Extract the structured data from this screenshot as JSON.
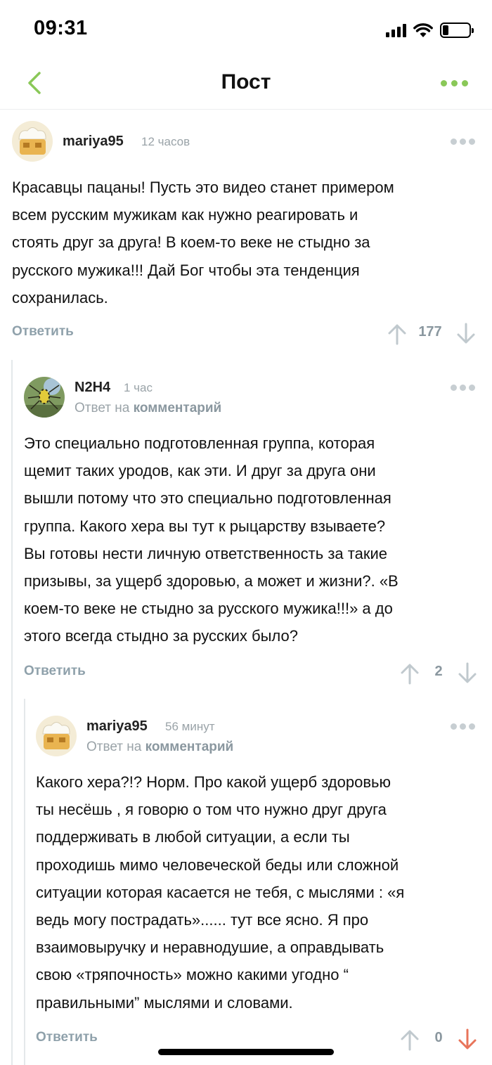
{
  "status_bar": {
    "time": "09:31"
  },
  "header": {
    "title": "Пост",
    "back_icon": "chevron-left-icon",
    "more_icon": "more-dots-icon",
    "accent": "#8ac858"
  },
  "reply_label": "Ответить",
  "reply_to": {
    "prefix": "Ответ на",
    "link": "комментарий"
  },
  "comments": [
    {
      "user": "mariya95",
      "time": "12 часов",
      "text_lines": [
        "Красавцы пацаны! Пусть это видео станет примером",
        "всем русским мужикам как нужно реагировать и",
        "стоять друг за друга! В коем-то веке не стыдно за",
        "русского мужика!!! Дай Бог чтобы эта тенденция",
        "сохранилась."
      ],
      "score": "177"
    },
    {
      "user": "N2H4",
      "time": "1 час",
      "text_lines": [
        "Это специально подготовленная группа, которая",
        "щемит таких уродов, как эти. И друг за друга они",
        "вышли потому что это специально подготовленная",
        "группа. Какого хера вы тут к рыцарству взываете?",
        "Вы готовы нести личную ответственность за такие",
        "призывы, за ущерб здоровью, а может и жизни?. «В",
        "коем-то веке не стыдно за русского мужика!!!» а до",
        "этого всегда стыдно за русских было?"
      ],
      "score": "2"
    },
    {
      "user": "mariya95",
      "time": "56 минут",
      "text_lines": [
        "Какого хера?!? Норм. Про какой ущерб здоровью",
        "ты несёшь , я говорю о том что нужно друг друга",
        "поддерживать в любой ситуации, а если ты",
        "проходишь мимо человеческой беды или сложной",
        "ситуации которая касается не тебя, с мыслями : «я",
        "ведь могу пострадать»...... тут все ясно. Я про",
        "взаимовыручку и неравнодушие, а оправдывать",
        "свою «тряпочность» можно какими угодно “",
        "правильными” мыслями и словами."
      ],
      "score": "0",
      "downvote_color": "#e8745a"
    }
  ]
}
